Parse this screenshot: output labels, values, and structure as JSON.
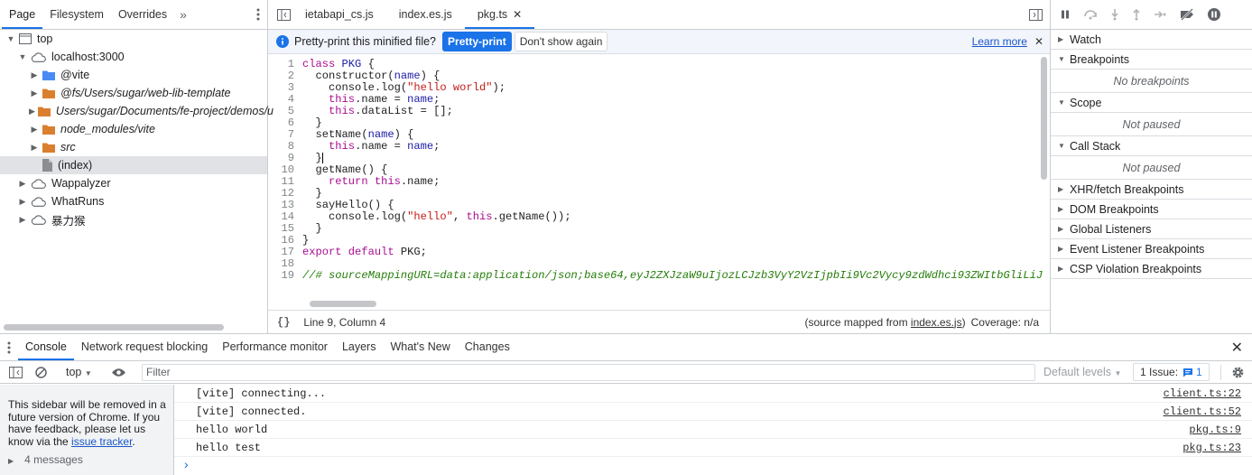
{
  "navigator": {
    "tabs": [
      "Page",
      "Filesystem",
      "Overrides"
    ],
    "more": "»",
    "tree": [
      {
        "label": "top",
        "depth": 0,
        "arrow": "▼",
        "icon": "frame-icon",
        "italic": false,
        "selected": false
      },
      {
        "label": "localhost:3000",
        "depth": 1,
        "arrow": "▼",
        "icon": "cloud-icon",
        "italic": false,
        "selected": false
      },
      {
        "label": "@vite",
        "depth": 2,
        "arrow": "▶",
        "icon": "folder-blue-icon",
        "italic": false,
        "selected": false
      },
      {
        "label": "@fs/Users/sugar/web-lib-template",
        "depth": 2,
        "arrow": "▶",
        "icon": "folder-icon",
        "italic": true,
        "selected": false
      },
      {
        "label": "Users/sugar/Documents/fe-project/demos/u",
        "depth": 2,
        "arrow": "▶",
        "icon": "folder-icon",
        "italic": true,
        "selected": false
      },
      {
        "label": "node_modules/vite",
        "depth": 2,
        "arrow": "▶",
        "icon": "folder-icon",
        "italic": true,
        "selected": false
      },
      {
        "label": "src",
        "depth": 2,
        "arrow": "▶",
        "icon": "folder-icon",
        "italic": true,
        "selected": false
      },
      {
        "label": "(index)",
        "depth": 2,
        "arrow": "",
        "icon": "file-icon",
        "italic": false,
        "selected": true
      },
      {
        "label": "Wappalyzer",
        "depth": 1,
        "arrow": "▶",
        "icon": "cloud-icon",
        "italic": false,
        "selected": false
      },
      {
        "label": "WhatRuns",
        "depth": 1,
        "arrow": "▶",
        "icon": "cloud-icon",
        "italic": false,
        "selected": false
      },
      {
        "label": "暴力猴",
        "depth": 1,
        "arrow": "▶",
        "icon": "cloud-icon",
        "italic": false,
        "selected": false
      }
    ]
  },
  "editor": {
    "tabs": [
      {
        "label": "ietabapi_cs.js",
        "active": false,
        "closable": false
      },
      {
        "label": "index.es.js",
        "active": false,
        "closable": false
      },
      {
        "label": "pkg.ts",
        "active": true,
        "closable": true
      }
    ],
    "infobar": {
      "message": "Pretty-print this minified file?",
      "pretty_print": "Pretty-print",
      "dont_show": "Don't show again",
      "learn_more": "Learn more"
    },
    "code": [
      [
        {
          "t": "class ",
          "c": "kw"
        },
        {
          "t": "PKG",
          "c": "cls"
        },
        {
          "t": " {",
          "c": ""
        }
      ],
      [
        {
          "t": "  constructor(",
          "c": ""
        },
        {
          "t": "name",
          "c": "nm"
        },
        {
          "t": ") {",
          "c": ""
        }
      ],
      [
        {
          "t": "    console.log(",
          "c": ""
        },
        {
          "t": "\"hello world\"",
          "c": "str"
        },
        {
          "t": ");",
          "c": ""
        }
      ],
      [
        {
          "t": "    ",
          "c": ""
        },
        {
          "t": "this",
          "c": "kw"
        },
        {
          "t": ".name = ",
          "c": ""
        },
        {
          "t": "name",
          "c": "nm"
        },
        {
          "t": ";",
          "c": ""
        }
      ],
      [
        {
          "t": "    ",
          "c": ""
        },
        {
          "t": "this",
          "c": "kw"
        },
        {
          "t": ".dataList = [];",
          "c": ""
        }
      ],
      [
        {
          "t": "  }",
          "c": ""
        }
      ],
      [
        {
          "t": "  setName(",
          "c": ""
        },
        {
          "t": "name",
          "c": "nm"
        },
        {
          "t": ") {",
          "c": ""
        }
      ],
      [
        {
          "t": "    ",
          "c": ""
        },
        {
          "t": "this",
          "c": "kw"
        },
        {
          "t": ".name = ",
          "c": ""
        },
        {
          "t": "name",
          "c": "nm"
        },
        {
          "t": ";",
          "c": ""
        }
      ],
      [
        {
          "t": "  }",
          "c": ""
        }
      ],
      [
        {
          "t": "  getName() {",
          "c": ""
        }
      ],
      [
        {
          "t": "    ",
          "c": ""
        },
        {
          "t": "return",
          "c": "kw"
        },
        {
          "t": " ",
          "c": ""
        },
        {
          "t": "this",
          "c": "kw"
        },
        {
          "t": ".name;",
          "c": ""
        }
      ],
      [
        {
          "t": "  }",
          "c": ""
        }
      ],
      [
        {
          "t": "  sayHello() {",
          "c": ""
        }
      ],
      [
        {
          "t": "    console.log(",
          "c": ""
        },
        {
          "t": "\"hello\"",
          "c": "str"
        },
        {
          "t": ", ",
          "c": ""
        },
        {
          "t": "this",
          "c": "kw"
        },
        {
          "t": ".getName());",
          "c": ""
        }
      ],
      [
        {
          "t": "  }",
          "c": ""
        }
      ],
      [
        {
          "t": "}",
          "c": ""
        }
      ],
      [
        {
          "t": "export default",
          "c": "kw"
        },
        {
          "t": " PKG;",
          "c": ""
        }
      ],
      [
        {
          "t": "",
          "c": ""
        }
      ],
      [
        {
          "t": "//# sourceMappingURL=data:application/json;base64,eyJ2ZXJzaW9uIjozLCJzb3VyY2VzIjpbIi9Vc2Vycy9zdWdhci93ZWItbGliLiJ",
          "c": "cm"
        }
      ]
    ],
    "status": {
      "position": "Line 9, Column 4",
      "source_prefix": "(source mapped from ",
      "source_link": "index.es.js",
      "source_suffix": ")",
      "coverage": "Coverage: n/a"
    }
  },
  "debugger": {
    "sections": [
      {
        "label": "Watch",
        "open": false,
        "body": ""
      },
      {
        "label": "Breakpoints",
        "open": true,
        "body": "No breakpoints"
      },
      {
        "label": "Scope",
        "open": true,
        "body": "Not paused"
      },
      {
        "label": "Call Stack",
        "open": true,
        "body": "Not paused"
      },
      {
        "label": "XHR/fetch Breakpoints",
        "open": false,
        "body": ""
      },
      {
        "label": "DOM Breakpoints",
        "open": false,
        "body": ""
      },
      {
        "label": "Global Listeners",
        "open": false,
        "body": ""
      },
      {
        "label": "Event Listener Breakpoints",
        "open": false,
        "body": ""
      },
      {
        "label": "CSP Violation Breakpoints",
        "open": false,
        "body": ""
      }
    ]
  },
  "drawer": {
    "tabs": [
      "Console",
      "Network request blocking",
      "Performance monitor",
      "Layers",
      "What's New",
      "Changes"
    ],
    "context": "top",
    "filter_placeholder": "Filter",
    "levels": "Default levels",
    "issues_label": "1 Issue:",
    "issues_count": "1",
    "sidebar_text": "This sidebar will be removed in a future version of Chrome. If you have feedback, please let us know via the ",
    "sidebar_link": "issue tracker",
    "sidebar_end": ".",
    "sidebar_cut": "4 messages",
    "messages": [
      {
        "text": "[vite] connecting...",
        "source": "client.ts:22"
      },
      {
        "text": "[vite] connected.",
        "source": "client.ts:52"
      },
      {
        "text": "hello world",
        "source": "pkg.ts:9"
      },
      {
        "text": "hello test",
        "source": "pkg.ts:23"
      }
    ],
    "prompt": "›"
  },
  "colors": {
    "accent": "#1a73e8",
    "keyword": "#aa0d91",
    "string": "#c41a16",
    "comment": "#237d08"
  }
}
